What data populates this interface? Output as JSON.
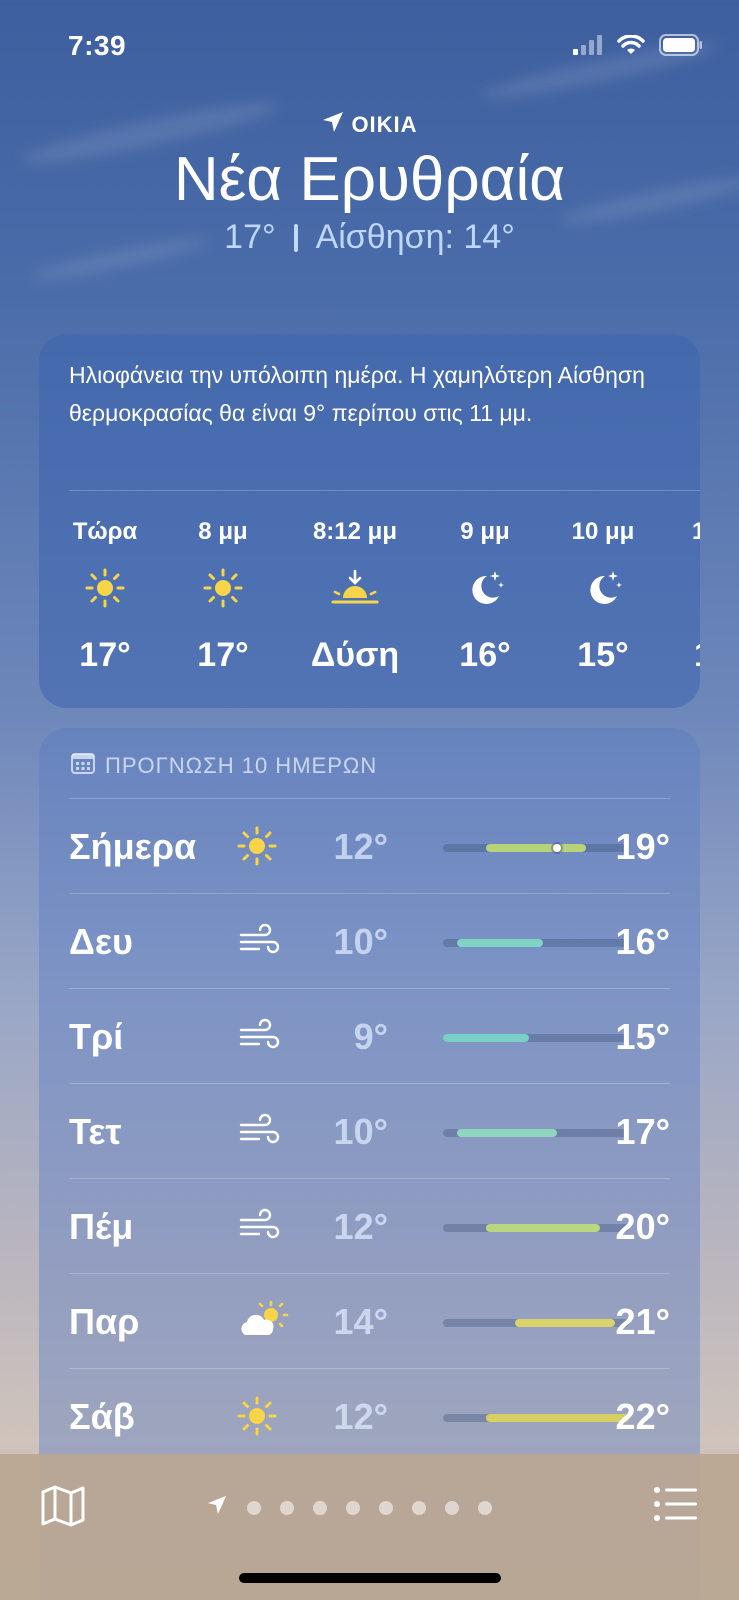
{
  "status_bar": {
    "time": "7:39"
  },
  "location": {
    "tag": "ΟΙΚΙΑ",
    "city": "Νέα Ερυθραία",
    "current_temp": "17°",
    "feels_like": "Αίσθηση: 14°"
  },
  "hourly": {
    "summary": "Ηλιοφάνεια την υπόλοιπη ημέρα. Η χαμηλότερη Αίσθηση θερμοκρασίας θα είναι 9° περίπου στις 11 μμ.",
    "items": [
      {
        "label": "Τώρα",
        "icon": "sun-icon",
        "value": "17°"
      },
      {
        "label": "8 μμ",
        "icon": "sun-icon",
        "value": "17°"
      },
      {
        "label": "8:12 μμ",
        "icon": "sunset-icon",
        "value": "Δύση"
      },
      {
        "label": "9 μμ",
        "icon": "moon-stars-icon",
        "value": "16°"
      },
      {
        "label": "10 μμ",
        "icon": "moon-stars-icon",
        "value": "15°"
      },
      {
        "label": "1",
        "icon": "moon-stars-icon",
        "value": "1"
      }
    ]
  },
  "forecast": {
    "header": "ΠΡΟΓΝΩΣΗ 10 ΗΜΕΡΩΝ",
    "range_min": 9,
    "range_max": 22,
    "days": [
      {
        "day": "Σήμερα",
        "icon": "sun-icon",
        "low": "12°",
        "high": "19°",
        "low_val": 12,
        "high_val": 19,
        "current_val": 17,
        "color": "#b7d37a"
      },
      {
        "day": "Δευ",
        "icon": "wind-icon",
        "low": "10°",
        "high": "16°",
        "low_val": 10,
        "high_val": 16,
        "color": "#7fd3c4"
      },
      {
        "day": "Τρί",
        "icon": "wind-icon",
        "low": "9°",
        "high": "15°",
        "low_val": 9,
        "high_val": 15,
        "color": "#78d0c6"
      },
      {
        "day": "Τετ",
        "icon": "wind-icon",
        "low": "10°",
        "high": "17°",
        "low_val": 10,
        "high_val": 17,
        "color": "#8ed6c0"
      },
      {
        "day": "Πέμ",
        "icon": "wind-icon",
        "low": "12°",
        "high": "20°",
        "low_val": 12,
        "high_val": 20,
        "color": "#b9d77e"
      },
      {
        "day": "Παρ",
        "icon": "partly-sunny-icon",
        "low": "14°",
        "high": "21°",
        "low_val": 14,
        "high_val": 21,
        "color": "#d9d36a"
      },
      {
        "day": "Σάβ",
        "icon": "sun-icon",
        "low": "12°",
        "high": "22°",
        "low_val": 12,
        "high_val": 22,
        "color": "#d8cf62"
      }
    ]
  },
  "bottom_bar": {
    "page_count": 8
  }
}
